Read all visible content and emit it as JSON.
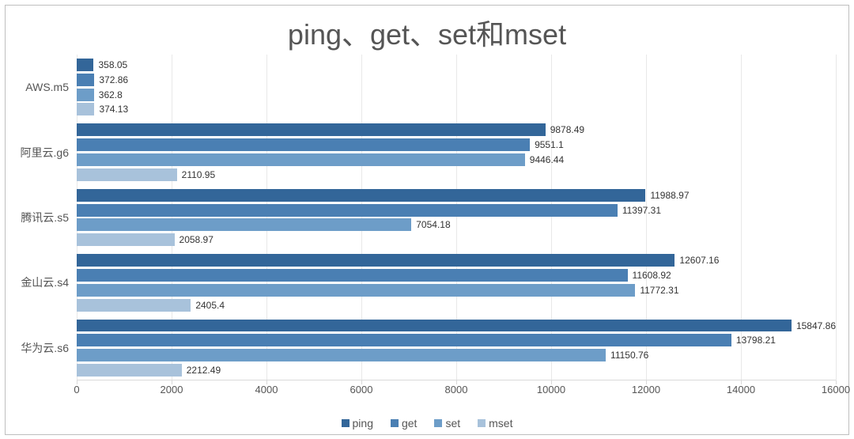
{
  "chart_data": {
    "type": "bar",
    "orientation": "horizontal",
    "title": "ping、get、set和mset",
    "xlabel": "",
    "ylabel": "",
    "xlim": [
      0,
      16000
    ],
    "xticks": [
      0,
      2000,
      4000,
      6000,
      8000,
      10000,
      12000,
      14000,
      16000
    ],
    "categories": [
      "AWS.m5",
      "阿里云.g6",
      "腾讯云.s5",
      "金山云.s4",
      "华为云.s6"
    ],
    "series": [
      {
        "name": "ping",
        "color": "#336699",
        "values": [
          358.05,
          9878.49,
          11988.97,
          12607.16,
          15847.86
        ]
      },
      {
        "name": "get",
        "color": "#4a7fb3",
        "values": [
          372.86,
          9551.1,
          11397.31,
          11608.92,
          13798.21
        ]
      },
      {
        "name": "set",
        "color": "#6d9dc8",
        "values": [
          362.8,
          9446.44,
          7054.18,
          11772.31,
          11150.76
        ]
      },
      {
        "name": "mset",
        "color": "#a8c2db",
        "values": [
          374.13,
          2110.95,
          2058.97,
          2405.4,
          2212.49
        ]
      }
    ],
    "legend_position": "bottom",
    "grid": true
  }
}
